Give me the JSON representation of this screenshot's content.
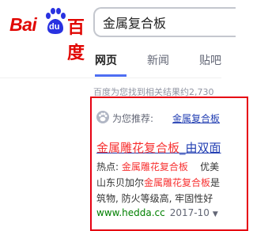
{
  "header": {
    "logo": {
      "latin": "Bai",
      "paw_text": "du",
      "cn": "百度"
    },
    "search": {
      "value": "金属复合板"
    }
  },
  "tabs": [
    {
      "label": "网页",
      "active": true
    },
    {
      "label": "新闻",
      "active": false
    },
    {
      "label": "贴吧",
      "active": false
    }
  ],
  "results": {
    "count_text": "百度为您找到相关结果约2,730",
    "recommend": {
      "label": "为您推荐:",
      "link": "金属复合板"
    },
    "first": {
      "title_em": "金属雕花复合板",
      "title_rest": "_由双面",
      "line1": {
        "prefix": "热点:",
        "em1": "金属雕花复合板",
        "rest": "优美"
      },
      "line2": {
        "text1": "山东贝加尔",
        "em1": "金属雕花复合板",
        "text2": "是"
      },
      "line3": "筑物, 防火等级高, 牢固性好",
      "url": "www.hedda.cc",
      "date": "2017-10"
    }
  },
  "colors": {
    "brand_red": "#e10602",
    "paw_blue": "#2932e1",
    "link_blue": "#2440b3",
    "highlight_red": "#e60012",
    "url_green": "#008000"
  }
}
